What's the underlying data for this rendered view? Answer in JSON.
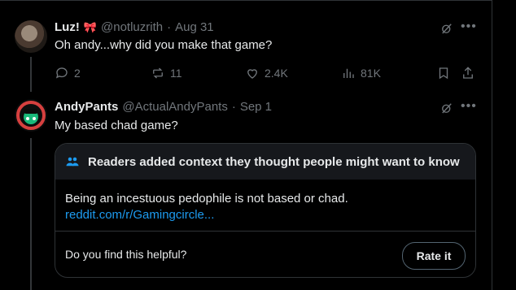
{
  "tweets": [
    {
      "name": "Luz!",
      "emoji": "🎀",
      "handle": "@notluzrith",
      "separator": "·",
      "date": "Aug 31",
      "text": "Oh andy...why did you make that game?",
      "actions": {
        "replies": "2",
        "reposts": "11",
        "likes": "2.4K",
        "views": "81K"
      }
    },
    {
      "name": "AndyPants",
      "handle": "@ActualAndyPants",
      "separator": "·",
      "date": "Sep 1",
      "text": "My based chad game?"
    }
  ],
  "note": {
    "header": "Readers added context they thought people might want to know",
    "body": "Being an incestuous pedophile is not based or chad.",
    "link": "reddit.com/r/Gamingcircle...",
    "question": "Do you find this helpful?",
    "rate_label": "Rate it"
  },
  "colors": {
    "accent": "#1d9bf0",
    "muted": "#71767b",
    "text": "#e7e9ea",
    "border": "#2f3336"
  },
  "icons": [
    "grok-icon",
    "more-icon",
    "reply-icon",
    "repost-icon",
    "like-icon",
    "views-icon",
    "bookmark-icon",
    "share-icon",
    "people-icon"
  ]
}
